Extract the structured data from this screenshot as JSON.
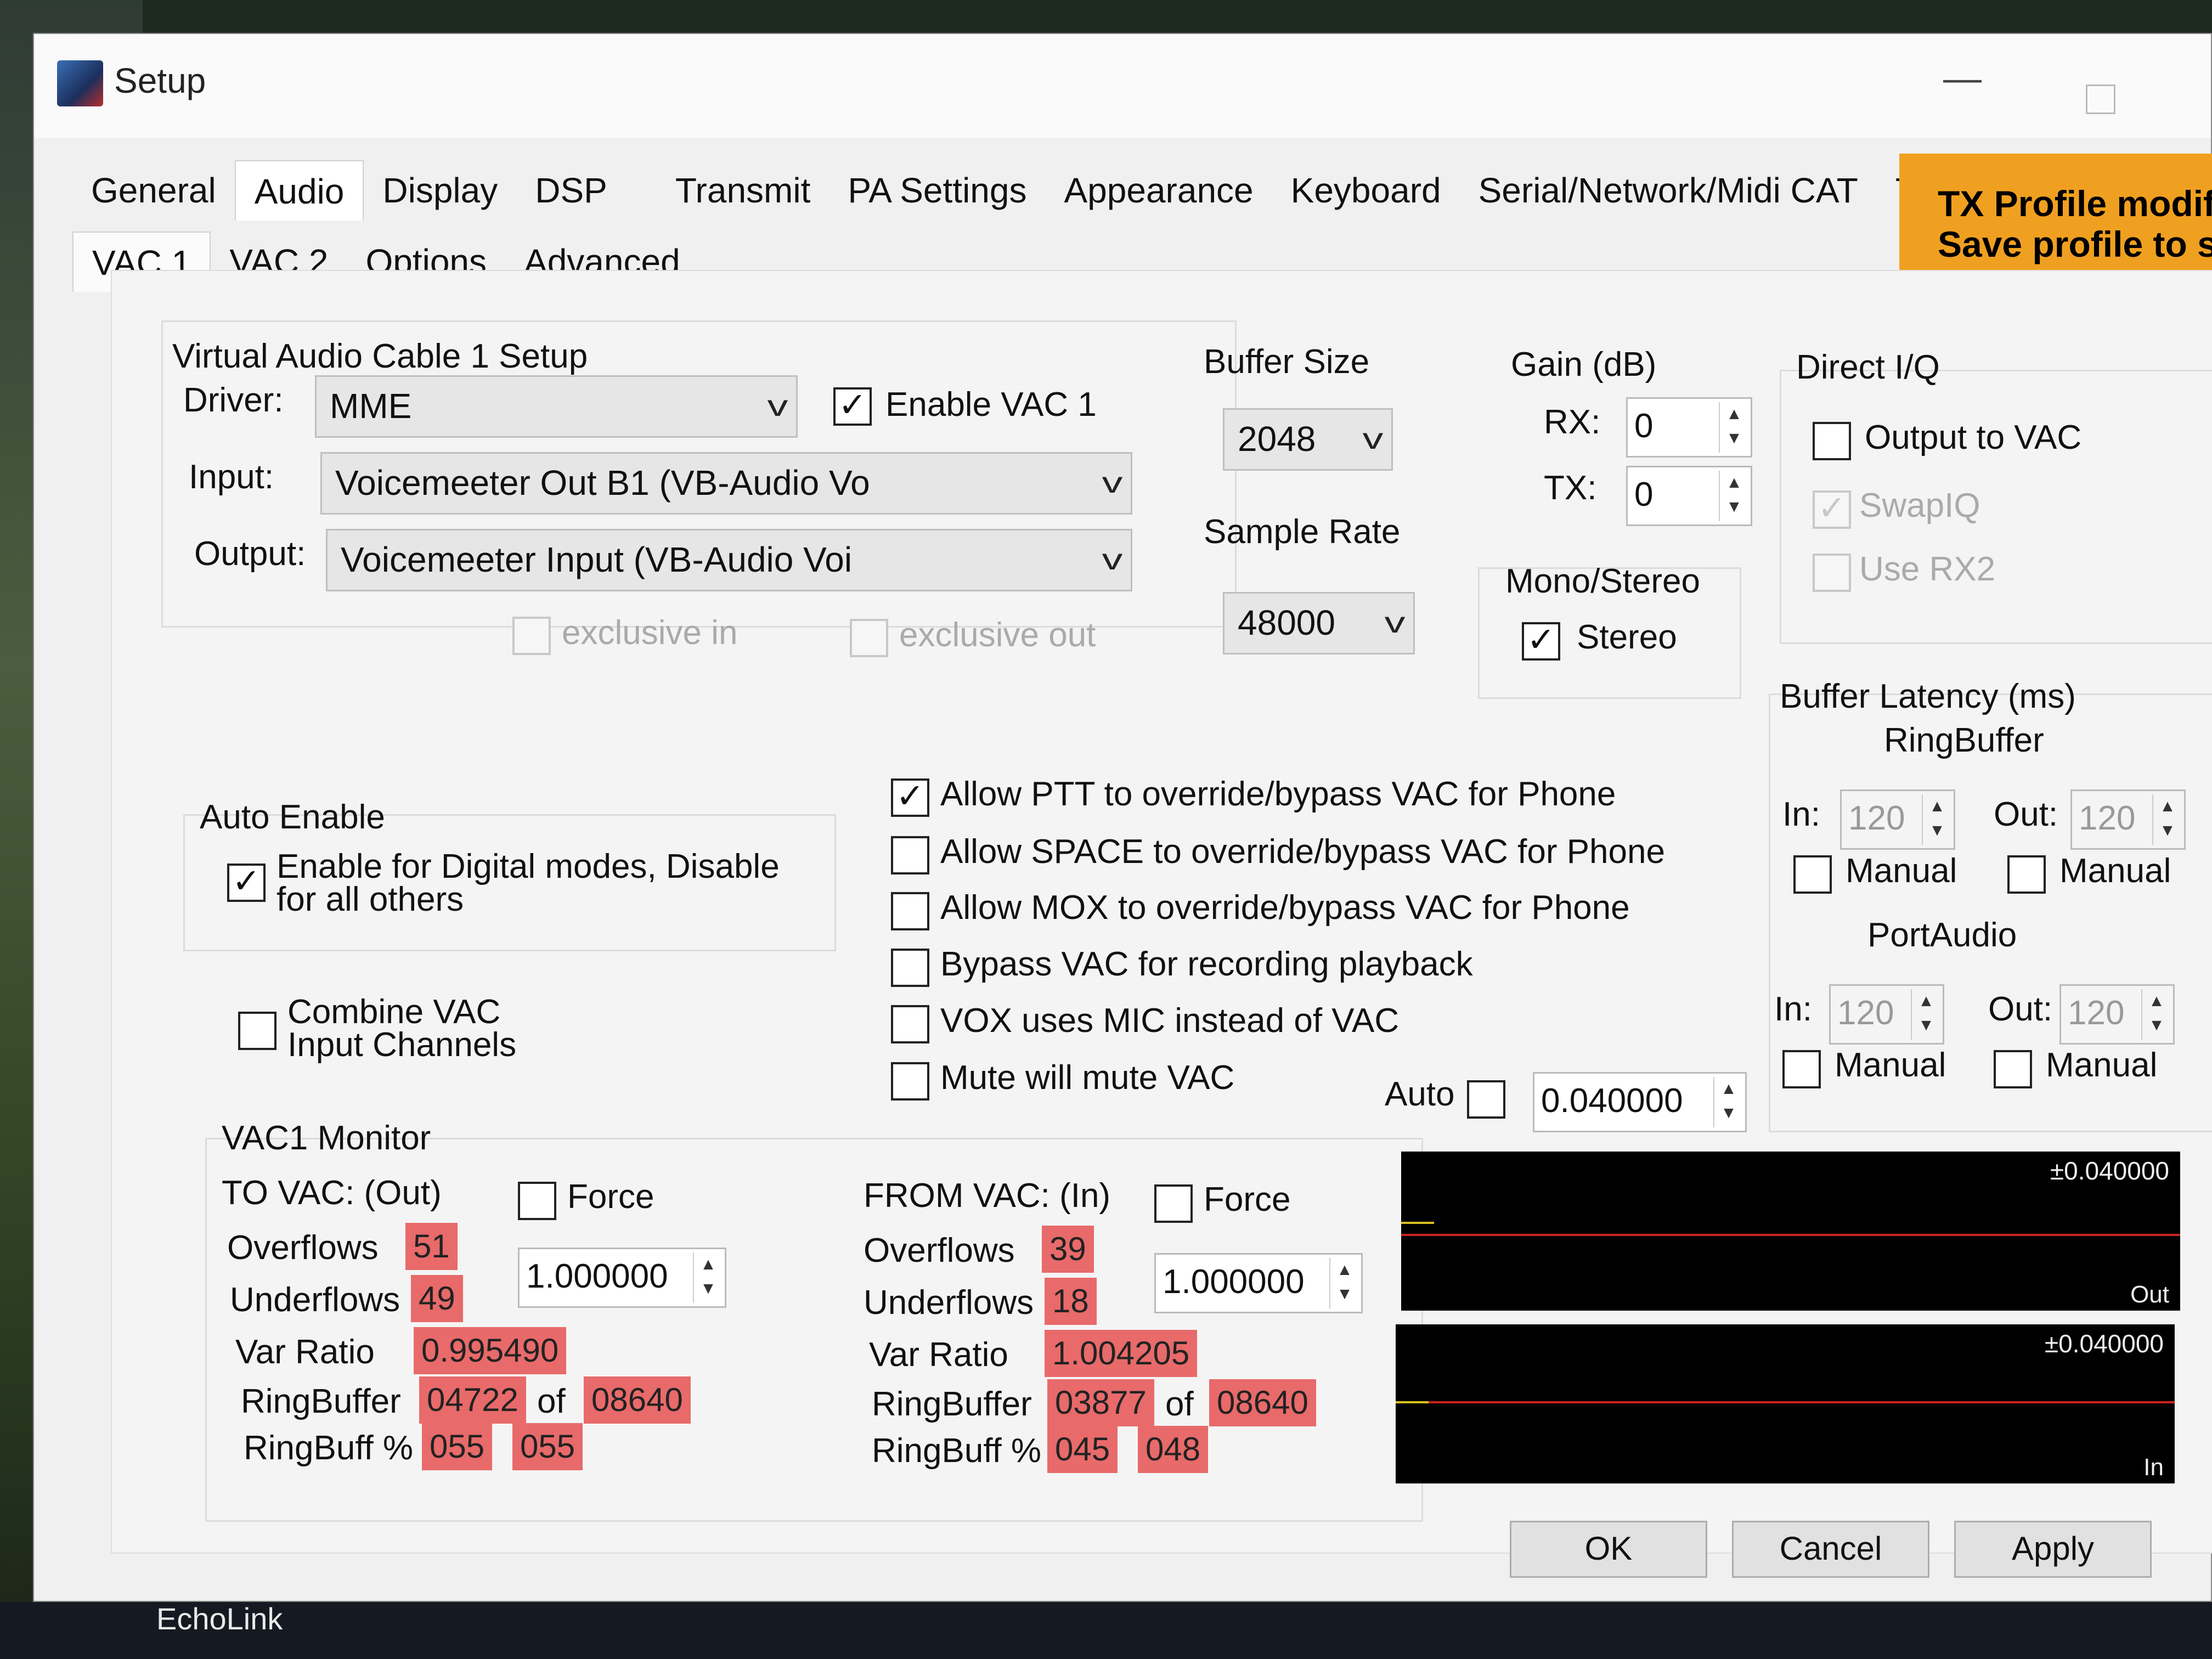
{
  "window": {
    "title": "Setup"
  },
  "tabs": [
    "General",
    "Audio",
    "Display",
    "DSP",
    "Transmit",
    "PA Settings",
    "Appearance",
    "Keyboard",
    "Serial/Network/Midi CAT",
    "Tests"
  ],
  "subtabs": [
    "VAC 1",
    "VAC 2",
    "Options",
    "Advanced"
  ],
  "tx_banner": {
    "line1": "TX Profile modifi",
    "line2": "Save profile to sto"
  },
  "vac_setup": {
    "title": "Virtual Audio Cable 1 Setup",
    "driver_label": "Driver:",
    "driver_value": "MME",
    "enable_label": "Enable VAC 1",
    "input_label": "Input:",
    "input_value": "Voicemeeter Out B1 (VB-Audio Vo",
    "output_label": "Output:",
    "output_value": "Voicemeeter Input (VB-Audio Voi",
    "exclusive_in": "exclusive in",
    "exclusive_out": "exclusive out"
  },
  "buffer": {
    "title": "Buffer Size",
    "value": "2048"
  },
  "sample_rate": {
    "title": "Sample Rate",
    "value": "48000"
  },
  "gain": {
    "title": "Gain (dB)",
    "rx_label": "RX:",
    "rx_value": "0",
    "tx_label": "TX:",
    "tx_value": "0"
  },
  "mono_stereo": {
    "title": "Mono/Stereo",
    "stereo_label": "Stereo"
  },
  "direct_iq": {
    "title": "Direct I/Q",
    "output_to_vac": "Output to VAC",
    "swap_iq": "SwapIQ",
    "use_rx2": "Use RX2"
  },
  "auto_enable": {
    "title": "Auto Enable",
    "line1": "Enable for Digital modes, Disable",
    "line2": "for all others"
  },
  "combine": {
    "line1": "Combine VAC",
    "line2": "Input Channels"
  },
  "options": [
    "Allow PTT to override/bypass VAC for Phone",
    "Allow SPACE to override/bypass VAC for Phone",
    "Allow MOX to override/bypass VAC for Phone",
    "Bypass VAC for recording playback",
    "VOX uses MIC instead of VAC",
    "Mute will mute VAC"
  ],
  "auto": {
    "label": "Auto",
    "value": "0.040000"
  },
  "latency": {
    "title": "Buffer Latency (ms)",
    "ringbuffer": "RingBuffer",
    "portaudio": "PortAudio",
    "in_label": "In:",
    "out_label": "Out:",
    "manual": "Manual",
    "rb_in": "120",
    "rb_out": "120",
    "pa_in": "120",
    "pa_out": "120"
  },
  "monitor": {
    "title": "VAC1 Monitor",
    "to_title": "TO VAC: (Out)",
    "from_title": "FROM VAC: (In)",
    "force": "Force",
    "overflows": "Overflows",
    "underflows": "Underflows",
    "var_ratio": "Var Ratio",
    "ringbuffer": "RingBuffer",
    "ringbuff_pct": "RingBuff %",
    "of": "of",
    "to": {
      "overflows": "51",
      "underflows": "49",
      "var_ratio": "0.995490",
      "rb_a": "04722",
      "rb_b": "08640",
      "pct_a": "055",
      "pct_b": "055",
      "ratio_spin": "1.000000"
    },
    "from": {
      "overflows": "39",
      "underflows": "18",
      "var_ratio": "1.004205",
      "rb_a": "03877",
      "rb_b": "08640",
      "pct_a": "045",
      "pct_b": "048",
      "ratio_spin": "1.000000"
    }
  },
  "scopes": {
    "out_value": "±0.040000",
    "out_label": "Out",
    "in_value": "±0.040000",
    "in_label": "In"
  },
  "buttons": {
    "ok": "OK",
    "cancel": "Cancel",
    "apply": "Apply"
  },
  "taskbar": {
    "echolink": "EchoLink"
  },
  "colors": {
    "stat_red": "#e86a6a",
    "banner_orange": "#f0a020",
    "scope_line": "#c22"
  }
}
